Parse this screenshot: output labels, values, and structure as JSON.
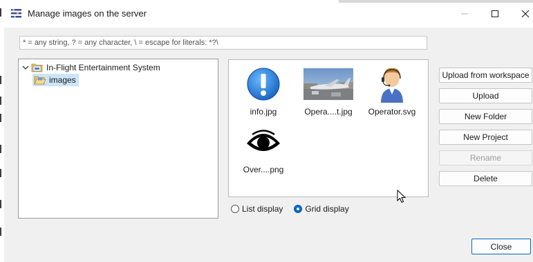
{
  "window": {
    "title": "Manage images on the server",
    "controls": {
      "minimize": "minimize",
      "maximize": "maximize",
      "close": "close"
    }
  },
  "filter": {
    "placeholder": "* = any string, ? = any character, \\ = escape for literals: *?\\"
  },
  "tree": {
    "root": {
      "label": "In-Flight Entertainment System",
      "expanded": true,
      "icon": "project-folder-icon"
    },
    "children": [
      {
        "label": "images",
        "selected": true,
        "icon": "open-folder-icon"
      }
    ]
  },
  "images": [
    {
      "caption": "info.jpg",
      "icon": "info-icon"
    },
    {
      "caption": "Opera....t.jpg",
      "icon": "airport-photo"
    },
    {
      "caption": "Operator.svg",
      "icon": "operator-icon"
    },
    {
      "caption": "Over....png",
      "icon": "eye-icon"
    }
  ],
  "display": {
    "list_label": "List display",
    "grid_label": "Grid display",
    "selected": "grid"
  },
  "actions": {
    "upload_workspace": "Upload from workspace",
    "upload": "Upload",
    "new_folder": "New Folder",
    "new_project": "New Project",
    "rename": "Rename",
    "delete": "Delete",
    "rename_enabled": false
  },
  "close_label": "Close",
  "colors": {
    "accent": "#0067c0",
    "selection": "#cce4f7",
    "info_blue": "#1e88e5"
  }
}
